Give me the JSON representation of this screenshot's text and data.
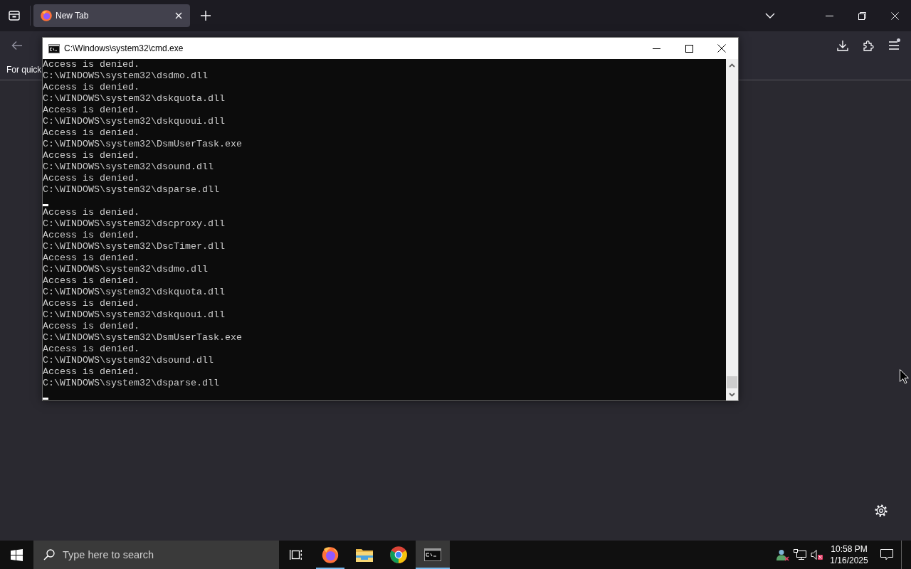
{
  "browser": {
    "tabs": [
      {
        "title": "New Tab",
        "selected": true
      }
    ],
    "back_enabled": false,
    "menu_notification": true,
    "bookmarks_hint": "For quick"
  },
  "console": {
    "title": "C:\\Windows\\system32\\cmd.exe",
    "lines": [
      {
        "kind": "output",
        "text": "Access is denied."
      },
      {
        "kind": "output",
        "text": "C:\\WINDOWS\\system32\\dsdmo.dll"
      },
      {
        "kind": "output",
        "text": "Access is denied."
      },
      {
        "kind": "output",
        "text": "C:\\WINDOWS\\system32\\dskquota.dll"
      },
      {
        "kind": "output",
        "text": "Access is denied."
      },
      {
        "kind": "output",
        "text": "C:\\WINDOWS\\system32\\dskquoui.dll"
      },
      {
        "kind": "output",
        "text": "Access is denied."
      },
      {
        "kind": "output",
        "text": "C:\\WINDOWS\\system32\\DsmUserTask.exe"
      },
      {
        "kind": "output",
        "text": "Access is denied."
      },
      {
        "kind": "output",
        "text": "C:\\WINDOWS\\system32\\dsound.dll"
      },
      {
        "kind": "output",
        "text": "Access is denied."
      },
      {
        "kind": "output",
        "text": "C:\\WINDOWS\\system32\\dsparse.dll"
      },
      {
        "kind": "cursor"
      },
      {
        "kind": "output",
        "text": "Access is denied."
      },
      {
        "kind": "output",
        "text": "C:\\WINDOWS\\system32\\dscproxy.dll"
      },
      {
        "kind": "output",
        "text": "Access is denied."
      },
      {
        "kind": "output",
        "text": "C:\\WINDOWS\\system32\\DscTimer.dll"
      },
      {
        "kind": "output",
        "text": "Access is denied."
      },
      {
        "kind": "output",
        "text": "C:\\WINDOWS\\system32\\dsdmo.dll"
      },
      {
        "kind": "output",
        "text": "Access is denied."
      },
      {
        "kind": "output",
        "text": "C:\\WINDOWS\\system32\\dskquota.dll"
      },
      {
        "kind": "output",
        "text": "Access is denied."
      },
      {
        "kind": "output",
        "text": "C:\\WINDOWS\\system32\\dskquoui.dll"
      },
      {
        "kind": "output",
        "text": "Access is denied."
      },
      {
        "kind": "output",
        "text": "C:\\WINDOWS\\system32\\DsmUserTask.exe"
      },
      {
        "kind": "output",
        "text": "Access is denied."
      },
      {
        "kind": "output",
        "text": "C:\\WINDOWS\\system32\\dsound.dll"
      },
      {
        "kind": "output",
        "text": "Access is denied."
      },
      {
        "kind": "output",
        "text": "C:\\WINDOWS\\system32\\dsparse.dll"
      },
      {
        "kind": "cursor"
      }
    ]
  },
  "taskbar": {
    "search": {
      "placeholder": "Type here to search"
    },
    "apps": [
      {
        "kind": "foxbrowser",
        "running": true,
        "selected": false
      },
      {
        "kind": "folder",
        "running": false,
        "selected": false
      },
      {
        "kind": "wheelbrowser",
        "running": false,
        "selected": false
      },
      {
        "kind": "terminal",
        "running": true,
        "selected": true
      }
    ],
    "tray": {
      "volume_muted": true,
      "time": "10:58 PM",
      "date": "1/16/2025"
    }
  }
}
